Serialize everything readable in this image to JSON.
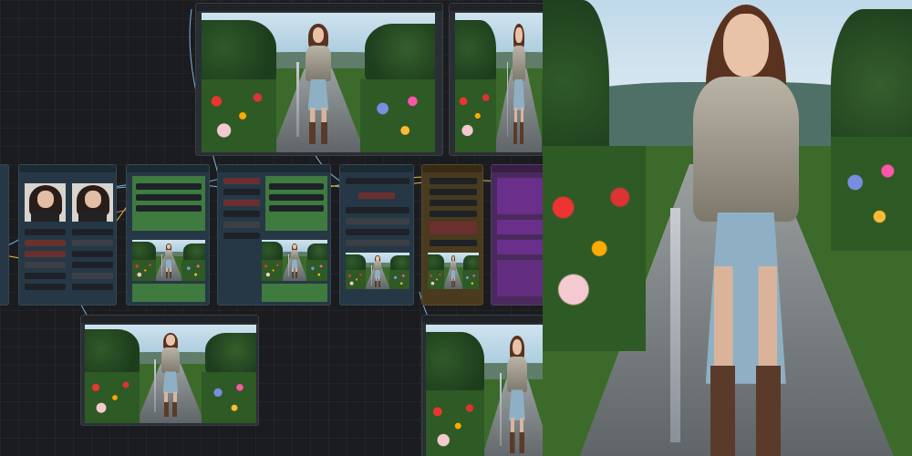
{
  "app": {
    "name": ""
  },
  "nodes": {
    "load_image_title": "",
    "sampler_title": "",
    "upscale_title": "",
    "save_title": ""
  },
  "preview": {
    "subject": "armored-swordswoman-on-garden-path"
  },
  "colors": {
    "canvas_bg": "#1b1c1f",
    "node_blue": "#263845",
    "node_brown": "#4a3a1e",
    "node_purple": "#4a2a5c",
    "link_blue": "#7fb3e0",
    "link_yellow": "#e3c04a"
  }
}
